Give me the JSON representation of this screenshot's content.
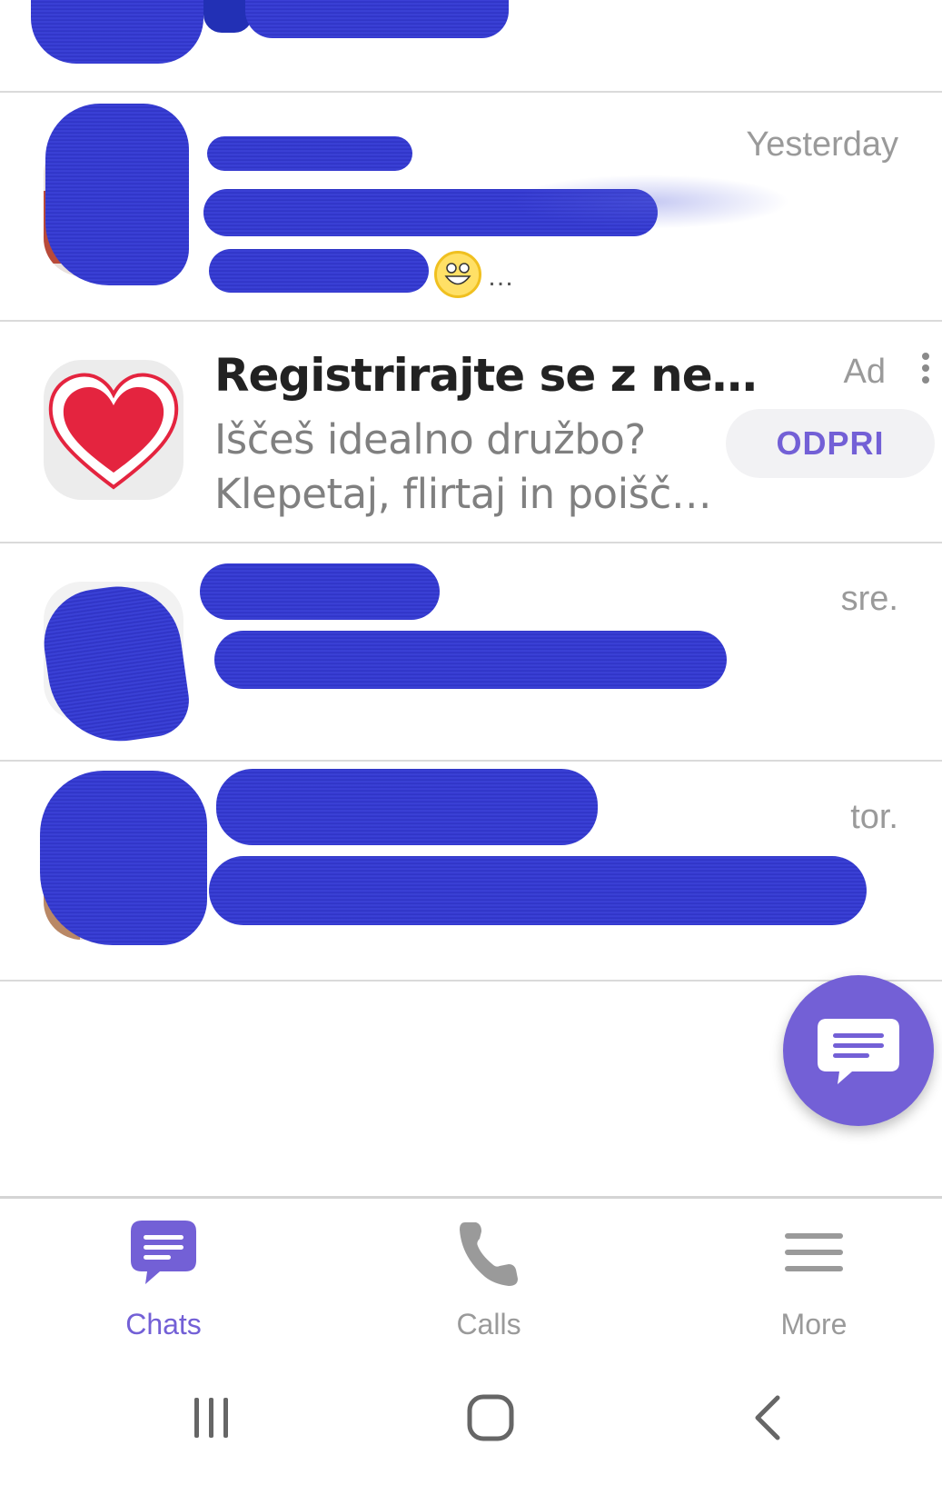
{
  "chat_list": {
    "rows": [
      {
        "time": ""
      },
      {
        "time": "Yesterday"
      },
      {
        "time": "sre."
      },
      {
        "time": "tor."
      }
    ]
  },
  "ad": {
    "title": "Registrirajte se z ne…",
    "description_line1": "Iščeš idealno družbo?",
    "description_line2": "Klepetaj, flirtaj in poišč…",
    "badge": "Ad",
    "button_label": "ODPRI"
  },
  "tabs": [
    {
      "label": "Chats",
      "icon": "chat-bubble-icon",
      "active": true
    },
    {
      "label": "Calls",
      "icon": "phone-icon",
      "active": false
    },
    {
      "label": "More",
      "icon": "hamburger-icon",
      "active": false
    }
  ],
  "colors": {
    "accent": "#7360d6",
    "muted": "#9a9a9a",
    "divider": "#dadada"
  }
}
